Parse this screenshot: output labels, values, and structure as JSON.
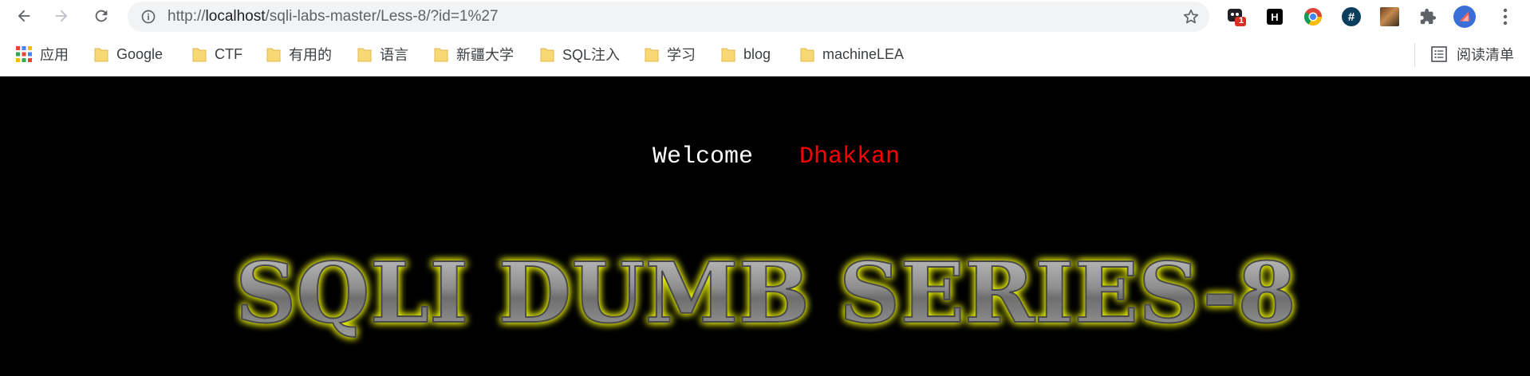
{
  "browser": {
    "url_prefix": "http://",
    "url_host": "localhost",
    "url_path": "/sqli-labs-master/Less-8/?id=1%27",
    "extension_badge": "1",
    "extension_h_label": "H",
    "extension_hash_label": "#"
  },
  "bookmarks": {
    "apps_label": "应用",
    "items": [
      "Google",
      "CTF",
      "有用的",
      "语言",
      "新疆大学",
      "SQL注入",
      "学习",
      "blog",
      "machineLEA"
    ],
    "reading_list_label": "阅读清单"
  },
  "page": {
    "welcome_text": "Welcome",
    "name_text": "Dhakkan",
    "banner_text": "SQLI DUMB SERIES-8"
  },
  "colors": {
    "welcome": "#ffffff",
    "name": "#ff0000",
    "banner_glow": "#e8f000",
    "folder": "#f8d775"
  }
}
